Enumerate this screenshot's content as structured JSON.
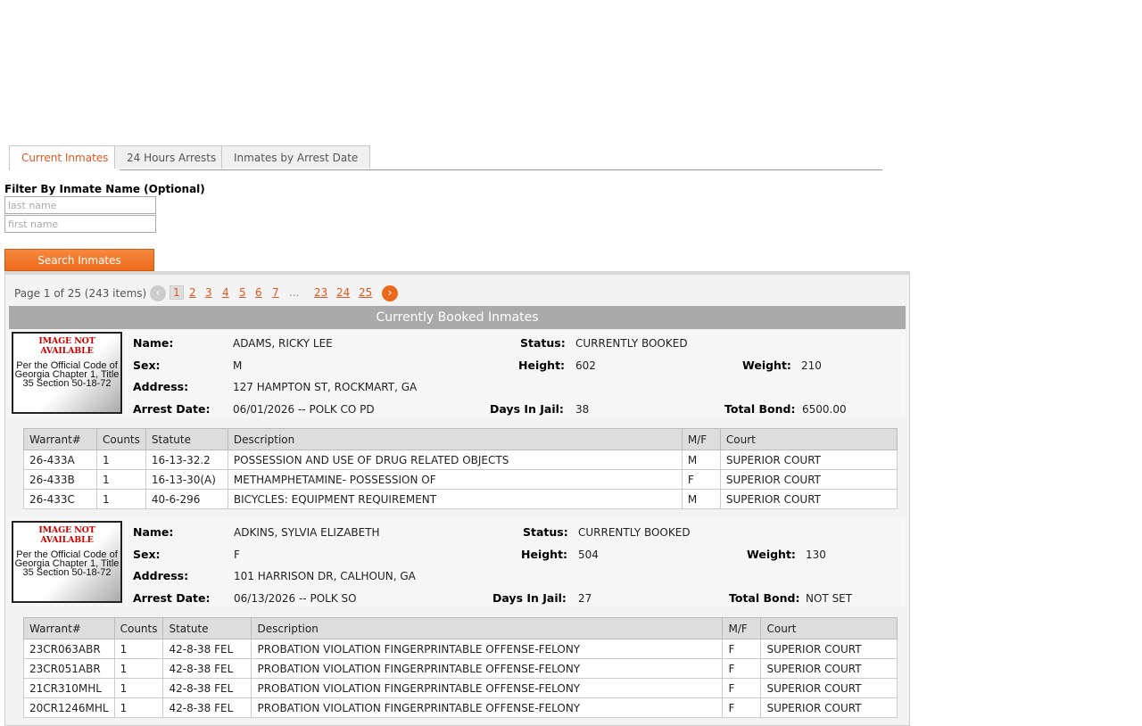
{
  "tabs": [
    {
      "label": "Current Inmates",
      "active": true
    },
    {
      "label": "24 Hours Arrests",
      "active": false
    },
    {
      "label": "Inmates by Arrest Date",
      "active": false
    }
  ],
  "filter": {
    "label": "Filter By Inmate Name (Optional)",
    "last_name_placeholder": "last name",
    "first_name_placeholder": "first name",
    "search_label": "Search Inmates"
  },
  "pager": {
    "info": "Page 1 of 25 (243 items)",
    "prev_icon": "chevron-left-icon",
    "next_icon": "chevron-right-icon",
    "prev_glyph": "‹",
    "next_glyph": "›",
    "pages": [
      "1",
      "2",
      "3",
      "4",
      "5",
      "6",
      "7"
    ],
    "ellipsis": "...",
    "last_pages": [
      "23",
      "24",
      "25"
    ]
  },
  "grid_title": "Currently Booked Inmates",
  "labels": {
    "name": "Name:",
    "status": "Status:",
    "sex": "Sex:",
    "height": "Height:",
    "weight": "Weight:",
    "address": "Address:",
    "arrest_date": "Arrest Date:",
    "days": "Days In Jail:",
    "bond": "Total Bond:"
  },
  "photo": {
    "not_available": "IMAGE NOT AVAILABLE",
    "code": "Per the Official Code of Georgia Chapter 1, Title 35 Section 50-18-72"
  },
  "charge_headers": [
    "Warrant#",
    "Counts",
    "Statute",
    "Description",
    "M/F",
    "Court"
  ],
  "inmates": [
    {
      "name": "ADAMS, RICKY LEE",
      "status": "CURRENTLY BOOKED",
      "sex": "M",
      "height": "602",
      "weight": "210",
      "address": "127 HAMPTON ST, ROCKMART, GA",
      "arrest_date": "06/01/2026 -- POLK CO PD",
      "days": "38",
      "bond": "6500.00",
      "charges": [
        [
          "26-433A",
          "1",
          "16-13-32.2",
          "POSSESSION AND USE OF DRUG RELATED OBJECTS",
          "M",
          "SUPERIOR COURT"
        ],
        [
          "26-433B",
          "1",
          "16-13-30(A)",
          "METHAMPHETAMINE- POSSESSION OF",
          "F",
          "SUPERIOR COURT"
        ],
        [
          "26-433C",
          "1",
          "40-6-296",
          "BICYCLES: EQUIPMENT REQUIREMENT",
          "M",
          "SUPERIOR COURT"
        ]
      ]
    },
    {
      "name": "ADKINS, SYLVIA ELIZABETH",
      "status": "CURRENTLY BOOKED",
      "sex": "F",
      "height": "504",
      "weight": "130",
      "address": "101 HARRISON DR, CALHOUN, GA",
      "arrest_date": "06/13/2026 -- POLK SO",
      "days": "27",
      "bond": "NOT SET",
      "charges": [
        [
          "23CR063ABR",
          "1",
          "42-8-38 FEL",
          "PROBATION VIOLATION FINGERPRINTABLE OFFENSE-FELONY",
          "F",
          "SUPERIOR COURT"
        ],
        [
          "23CR051ABR",
          "1",
          "42-8-38 FEL",
          "PROBATION VIOLATION FINGERPRINTABLE OFFENSE-FELONY",
          "F",
          "SUPERIOR COURT"
        ],
        [
          "21CR310MHL",
          "1",
          "42-8-38 FEL",
          "PROBATION VIOLATION FINGERPRINTABLE OFFENSE-FELONY",
          "F",
          "SUPERIOR COURT"
        ],
        [
          "20CR1246MHL",
          "1",
          "42-8-38 FEL",
          "PROBATION VIOLATION FINGERPRINTABLE OFFENSE-FELONY",
          "F",
          "SUPERIOR COURT"
        ]
      ]
    }
  ]
}
